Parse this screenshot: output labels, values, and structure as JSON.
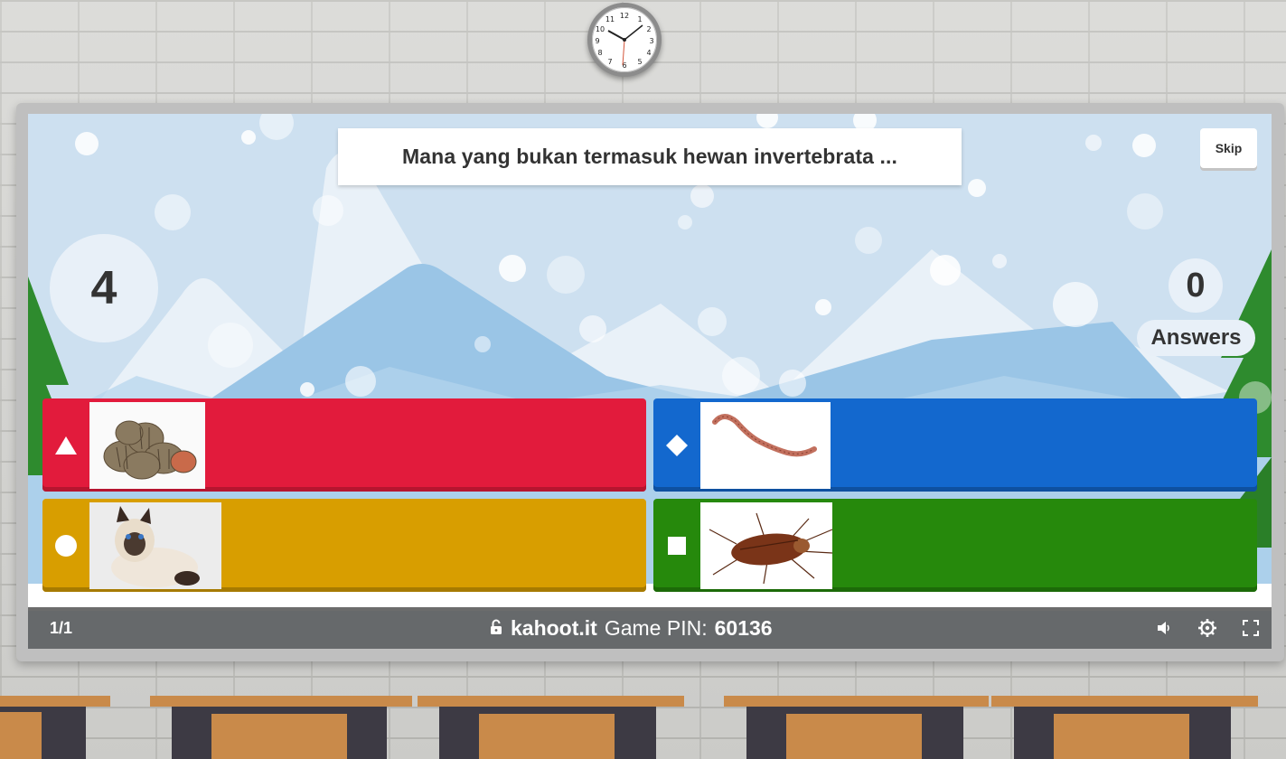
{
  "question": {
    "text": "Mana yang bukan termasuk hewan invertebrata ..."
  },
  "controls": {
    "skip_label": "Skip"
  },
  "timer": {
    "seconds": "4"
  },
  "answers_counter": {
    "count": "0",
    "label": "Answers"
  },
  "answers": [
    {
      "shape": "triangle",
      "color": "#e21b3c",
      "image": "cockles-shellfish"
    },
    {
      "shape": "diamond",
      "color": "#1368ce",
      "image": "earthworm"
    },
    {
      "shape": "circle",
      "color": "#d89e00",
      "image": "siamese-cat"
    },
    {
      "shape": "square",
      "color": "#26890c",
      "image": "cockroach"
    }
  ],
  "footer": {
    "progress": "1/1",
    "site": "kahoot.it",
    "pin_label": "Game PIN:",
    "pin": "60136",
    "icons": [
      "lock-open-icon",
      "volume-icon",
      "settings-gear-icon",
      "fullscreen-icon"
    ]
  },
  "clock": {
    "numbers": [
      "12",
      "1",
      "2",
      "3",
      "4",
      "5",
      "6",
      "7",
      "8",
      "9",
      "10",
      "11"
    ]
  }
}
